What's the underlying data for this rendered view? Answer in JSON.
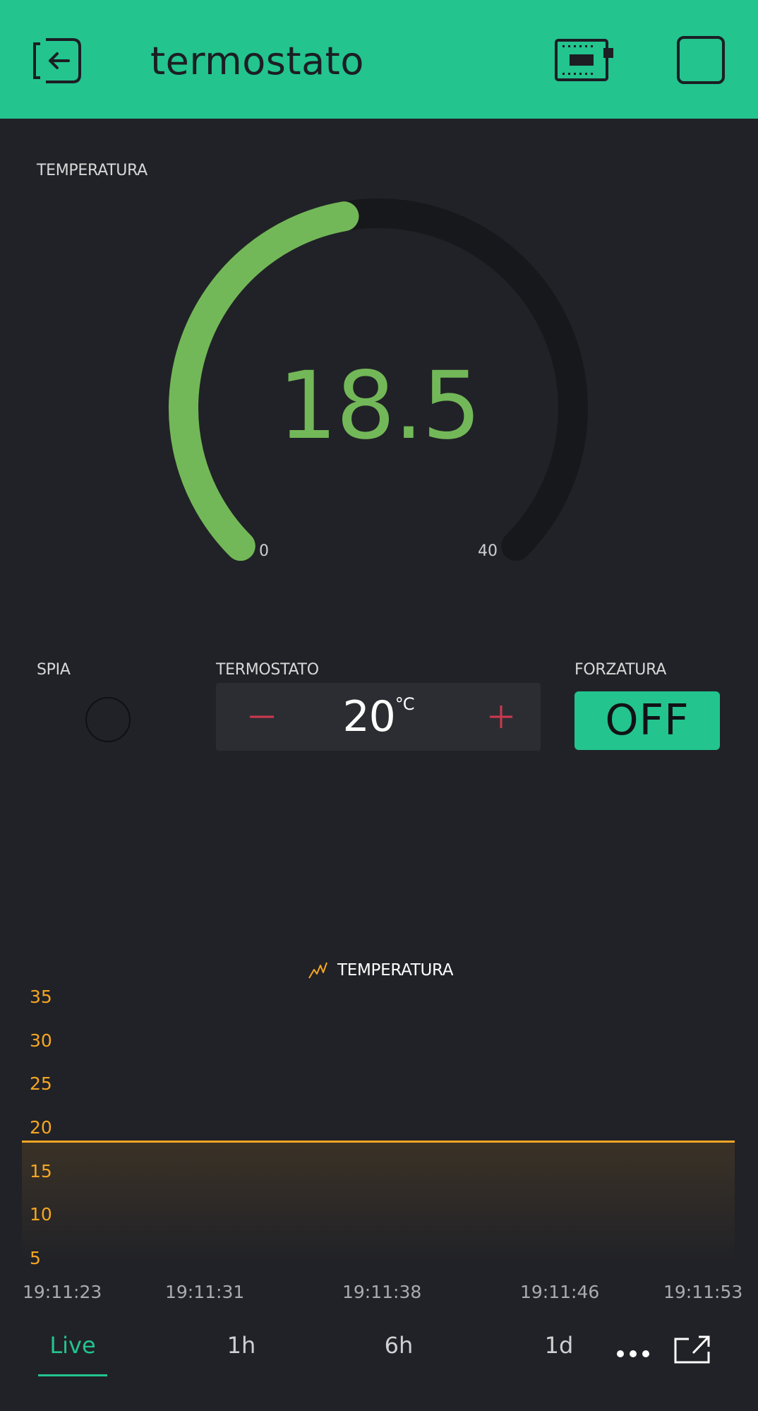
{
  "header": {
    "title": "termostato",
    "back_icon": "exit-icon",
    "device_icon": "device-chip-icon",
    "square_icon": "stop-square-icon"
  },
  "colors": {
    "header_bg": "#23c48e",
    "background": "#212227",
    "gauge_green": "#73b858",
    "chart_orange": "#f5a623",
    "stepper_red": "#d0384f"
  },
  "gauge": {
    "label": "TEMPERATURA",
    "value": "18.5",
    "min": "0",
    "max": "40",
    "fraction": 0.4625
  },
  "led": {
    "label": "SPIA",
    "on": false
  },
  "stepper": {
    "label": "TERMOSTATO",
    "value": "20",
    "unit": "°C",
    "minus": "−",
    "plus": "+"
  },
  "button": {
    "label": "FORZATURA",
    "text": "OFF"
  },
  "chart_data": {
    "type": "area",
    "series": [
      {
        "name": "TEMPERATURA",
        "x": [
          "19:11:23",
          "19:11:31",
          "19:11:38",
          "19:11:46",
          "19:11:53"
        ],
        "values": [
          18.5,
          18.5,
          18.5,
          18.5,
          18.5
        ]
      }
    ],
    "yticks": [
      "35",
      "30",
      "25",
      "20",
      "15",
      "10",
      "5"
    ],
    "xticks": [
      "19:11:23",
      "19:11:31",
      "19:11:38",
      "19:11:46",
      "19:11:53"
    ],
    "ylim": [
      5,
      35
    ]
  },
  "tabs": [
    {
      "label": "Live",
      "active": true
    },
    {
      "label": "1h",
      "active": false
    },
    {
      "label": "6h",
      "active": false
    },
    {
      "label": "1d",
      "active": false
    }
  ],
  "tab_icons": {
    "more": "more-dots-icon",
    "export": "export-icon"
  }
}
